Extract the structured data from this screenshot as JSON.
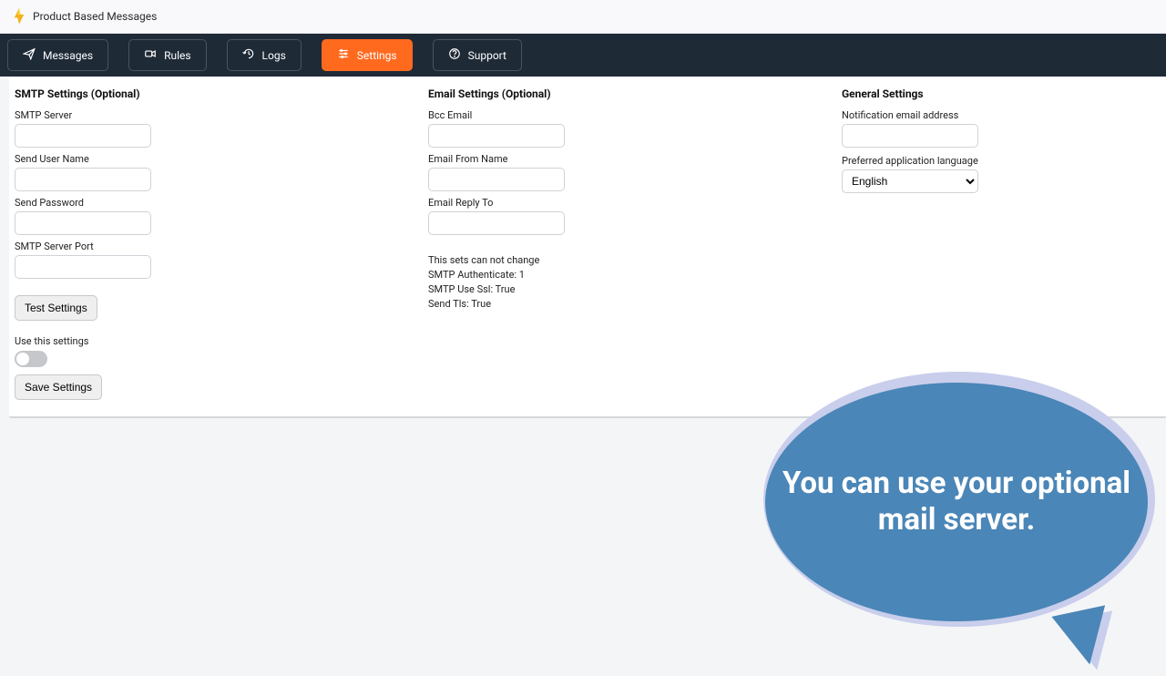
{
  "header": {
    "title": "Product Based Messages"
  },
  "nav": {
    "messages": "Messages",
    "rules": "Rules",
    "logs": "Logs",
    "settings": "Settings",
    "support": "Support"
  },
  "smtp": {
    "title": "SMTP Settings (Optional)",
    "server_label": "SMTP Server",
    "user_label": "Send User Name",
    "pass_label": "Send Password",
    "port_label": "SMTP Server Port",
    "test_btn": "Test Settings",
    "use_label": "Use this settings",
    "save_btn": "Save Settings"
  },
  "email": {
    "title": "Email Settings (Optional)",
    "bcc_label": "Bcc Email",
    "from_label": "Email From Name",
    "reply_label": "Email Reply To",
    "info1": "This sets can not change",
    "info2": "SMTP Authenticate: 1",
    "info3": "SMTP Use Ssl: True",
    "info4": "Send Tls: True"
  },
  "general": {
    "title": "General Settings",
    "notify_label": "Notification email address",
    "lang_label": "Preferred application language",
    "lang_value": "English"
  },
  "bubble": {
    "text": "You can use your optional mail server."
  }
}
